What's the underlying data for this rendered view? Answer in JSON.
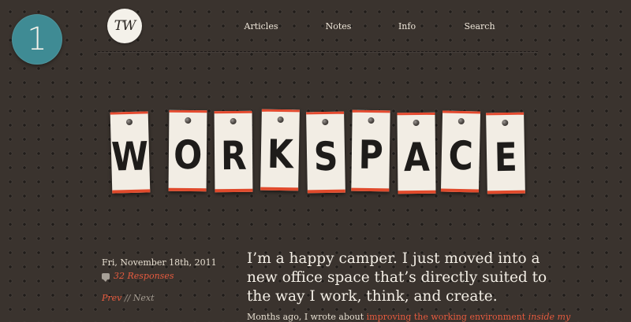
{
  "issue": {
    "number": "1"
  },
  "logo": {
    "text": "TW"
  },
  "nav": {
    "items": [
      "Articles",
      "Notes",
      "Info",
      "Search"
    ]
  },
  "banner": {
    "letters": [
      "W",
      "O",
      "R",
      "K",
      "S",
      "P",
      "A",
      "C",
      "E"
    ]
  },
  "post": {
    "date": "Fri, November 18th, 2011",
    "responses": "32 Responses",
    "pager": {
      "prev": "Prev",
      "sep": " // ",
      "next": "Next"
    },
    "lede": "I’m a happy camper. I just moved into a new office space that’s directly suited to the way I work, think, and create.",
    "body_start": "Months ago, I wrote about ",
    "body_link": "improving the working environment ",
    "body_link_em": "inside my"
  },
  "colors": {
    "accent": "#e65b3f",
    "badge": "#3f8b94",
    "background": "#3a332e"
  }
}
